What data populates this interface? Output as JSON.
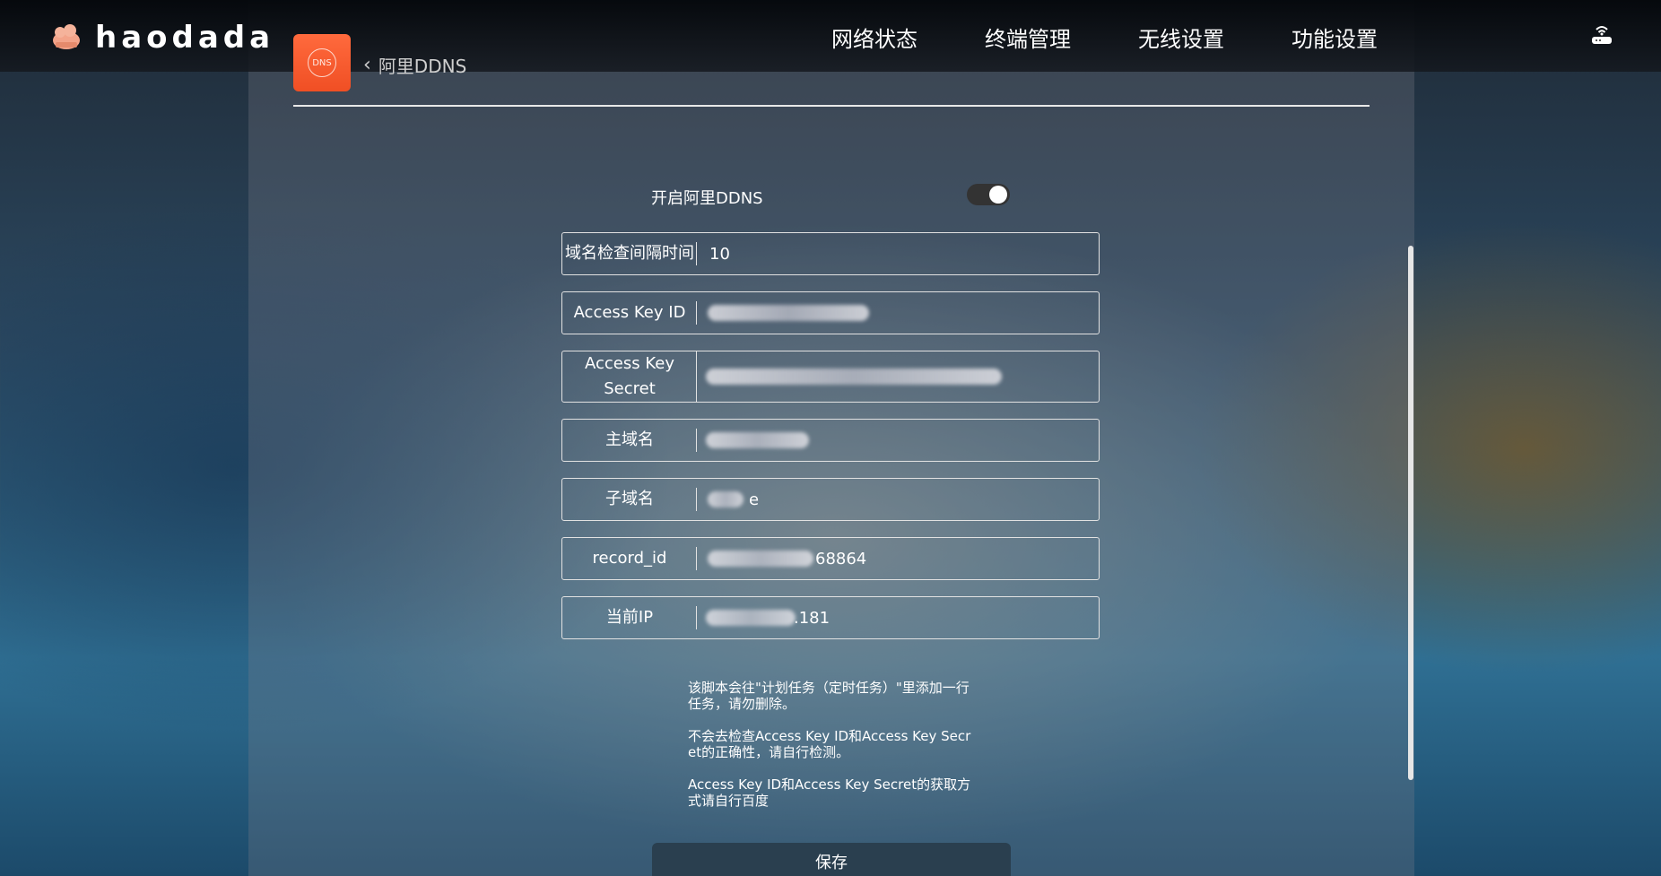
{
  "brand": {
    "name": "haodada"
  },
  "nav": {
    "items": [
      "网络状态",
      "终端管理",
      "无线设置",
      "功能设置"
    ]
  },
  "header": {
    "badge_text": "DNS",
    "breadcrumb": "阿里DDNS"
  },
  "form": {
    "toggle_label": "开启阿里DDNS",
    "toggle_on": true,
    "fields": [
      {
        "label": "域名检查间隔时间",
        "value": "10"
      },
      {
        "label": "Access Key ID",
        "value": ""
      },
      {
        "label": "Access Key Secret",
        "value": ""
      },
      {
        "label": "主域名",
        "value": ""
      },
      {
        "label": "子域名",
        "value": "e"
      },
      {
        "label": "record_id",
        "value": "68864"
      },
      {
        "label": "当前IP",
        "value": ".181"
      }
    ]
  },
  "notes": [
    "该脚本会往\"计划任务（定时任务）\"里添加一行任务，请勿删除。",
    "不会去检查Access Key ID和Access Key Secret的正确性，请自行检测。",
    "Access Key ID和Access Key Secret的获取方式请自行百度"
  ],
  "actions": {
    "save_label": "保存"
  },
  "colors": {
    "accent": "#f04f24",
    "toggle_track": "#333333"
  }
}
